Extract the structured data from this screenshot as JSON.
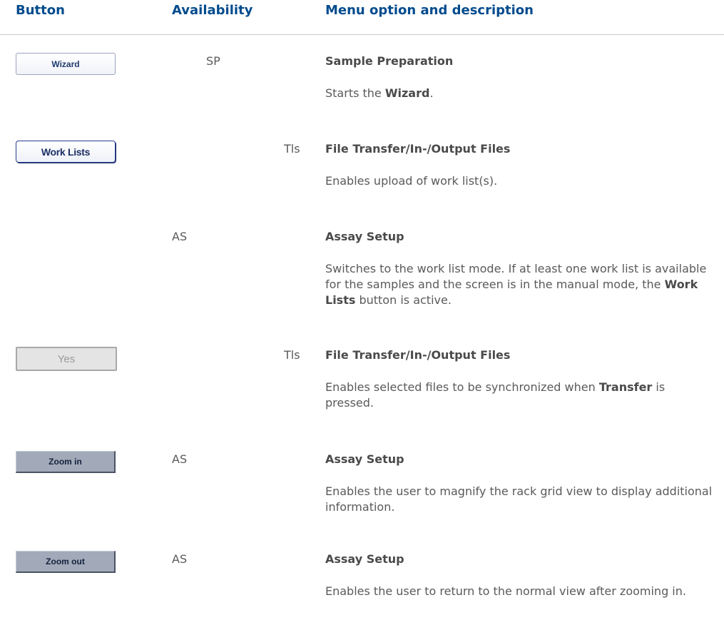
{
  "header": {
    "col_button": "Button",
    "col_availability": "Availability",
    "col_menu": "Menu option and description"
  },
  "rows": [
    {
      "button_label": "Wizard",
      "availability": "SP",
      "title": "Sample Preparation",
      "desc_pre": "Starts the ",
      "desc_bold": "Wizard",
      "desc_post": "."
    },
    {
      "button_label": "Work Lists",
      "availability": "Tls",
      "title": "File Transfer/In-/Output Files",
      "desc_pre": "Enables upload of work list(s).",
      "desc_bold": "",
      "desc_post": ""
    },
    {
      "button_label": "",
      "availability": "AS",
      "title": "Assay Setup",
      "desc_pre": "Switches to the work list mode. If at least one work list is available for the samples and the screen is in the manual mode, the ",
      "desc_bold": "Work Lists",
      "desc_post": " button is active."
    },
    {
      "button_label": "Yes",
      "availability": "Tls",
      "title": "File Transfer/In-/Output Files",
      "desc_pre": "Enables selected files to be synchronized when ",
      "desc_bold": "Transfer",
      "desc_post": " is pressed."
    },
    {
      "button_label": "Zoom in",
      "availability": "AS",
      "title": "Assay Setup",
      "desc_pre": "Enables the user to magnify the rack grid view to display additional information.",
      "desc_bold": "",
      "desc_post": ""
    },
    {
      "button_label": "Zoom out",
      "availability": "AS",
      "title": "Assay Setup",
      "desc_pre": "Enables the user to return to the normal view after zooming in.",
      "desc_bold": "",
      "desc_post": ""
    }
  ]
}
